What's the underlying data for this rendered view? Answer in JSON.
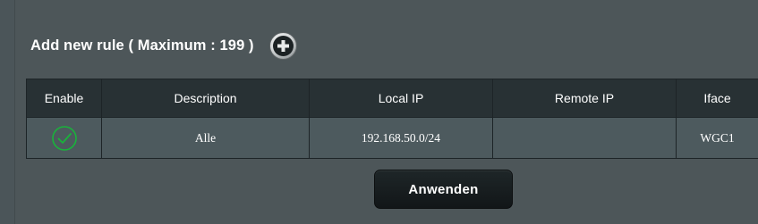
{
  "rules_section": {
    "title": "Add new rule ( Maximum : 199 )",
    "add_icon": "plus-circle-icon"
  },
  "table": {
    "headers": [
      "Enable",
      "Description",
      "Local IP",
      "Remote IP",
      "Iface"
    ],
    "rows": [
      {
        "enable_icon": "check-circle-icon",
        "enabled": true,
        "description": "Alle",
        "local_ip": "192.168.50.0/24",
        "remote_ip": "",
        "iface": "WGC1"
      }
    ]
  },
  "actions": {
    "apply_label": "Anwenden"
  },
  "colors": {
    "background": "#4d5659",
    "header_bg": "#283134",
    "row_bg": "#4d5a5e",
    "check_green": "#19b33b"
  }
}
